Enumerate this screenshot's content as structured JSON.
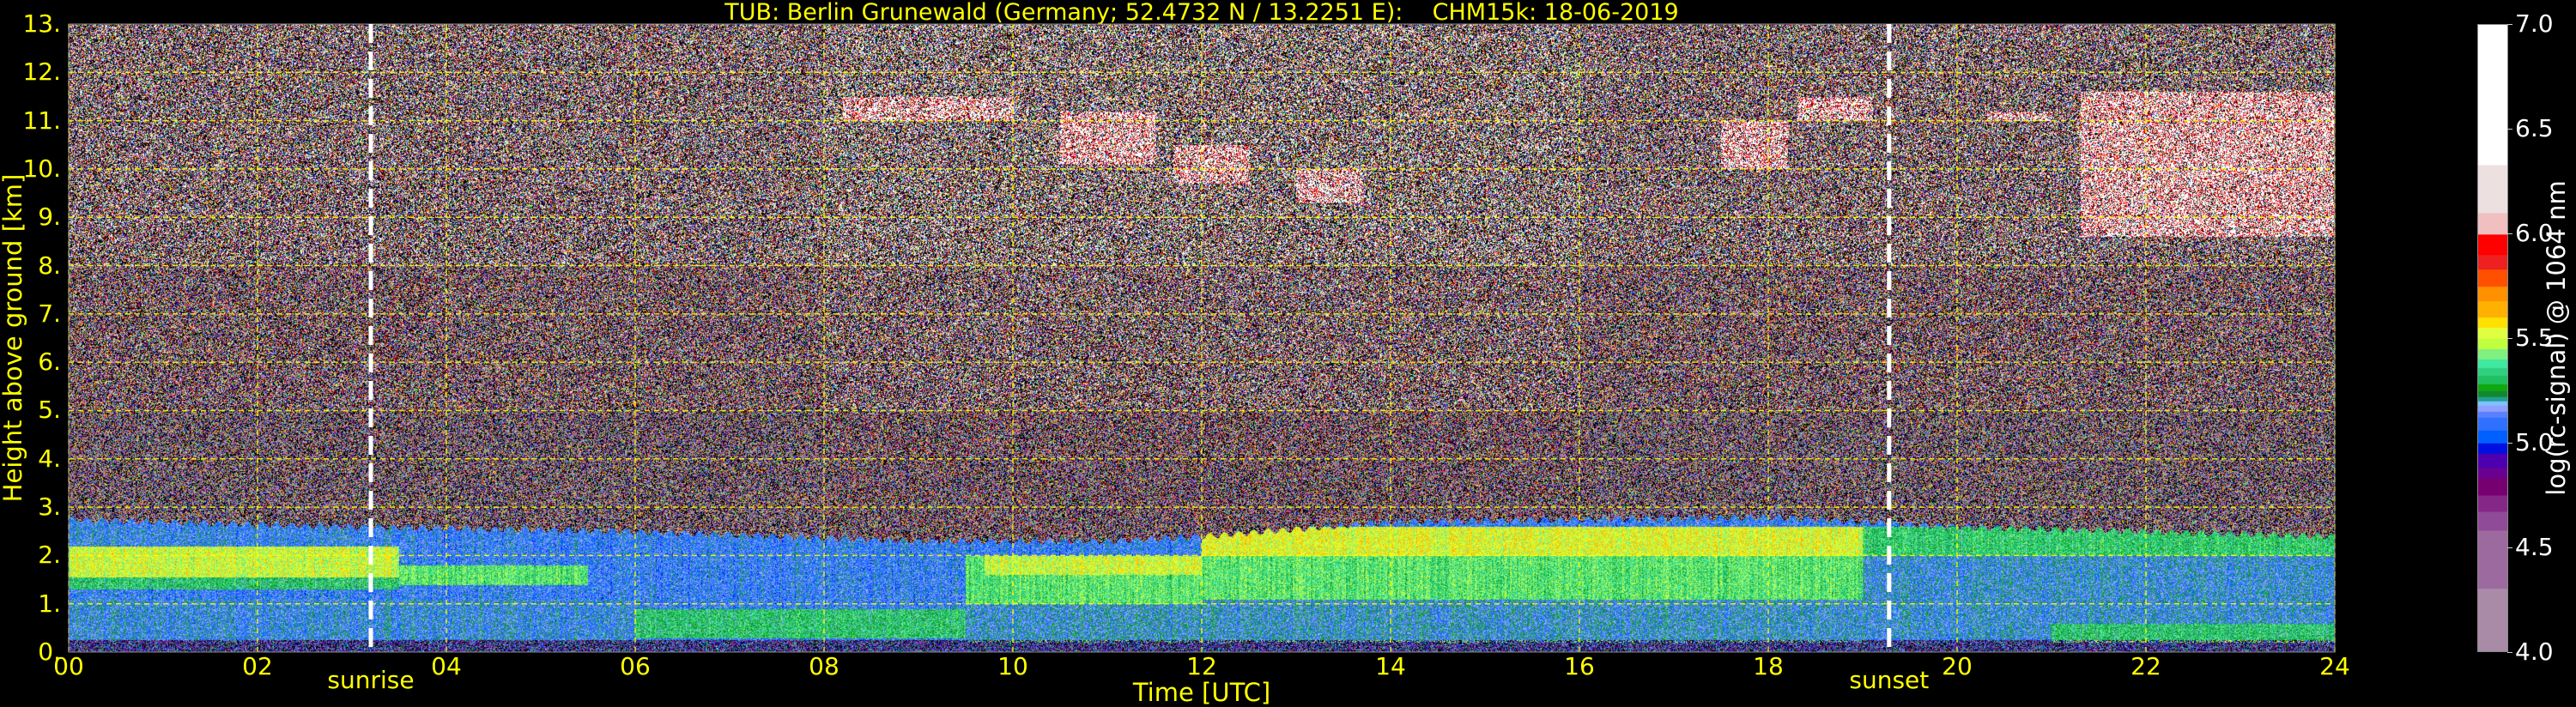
{
  "chart_data": {
    "type": "heatmap",
    "title": "TUB: Berlin Grunewald (Germany; 52.4732 N / 13.2251 E):    CHM15k: 18-06-2019",
    "xlabel": "Time [UTC]",
    "ylabel": "Height above ground [km]",
    "xlim": [
      0,
      24
    ],
    "ylim": [
      0,
      13
    ],
    "grid": true,
    "x_ticks": [
      0,
      2,
      4,
      6,
      8,
      10,
      12,
      14,
      16,
      18,
      20,
      22,
      24
    ],
    "x_tick_labels": [
      "00",
      "02",
      "04",
      "06",
      "08",
      "10",
      "12",
      "14",
      "16",
      "18",
      "20",
      "22",
      "24"
    ],
    "y_ticks": [
      0,
      1,
      2,
      3,
      4,
      5,
      6,
      7,
      8,
      9,
      10,
      11,
      12,
      13
    ],
    "y_tick_labels": [
      "0.",
      "1.",
      "2.",
      "3.",
      "4.",
      "5.",
      "6.",
      "7.",
      "8.",
      "9.",
      "10.",
      "11.",
      "12.",
      "13."
    ],
    "markers": [
      {
        "label": "sunrise",
        "hour": 3.2
      },
      {
        "label": "sunset",
        "hour": 19.28
      }
    ],
    "colorbar": {
      "label": "log(rc-signal) @ 1064 nm",
      "range": [
        4.0,
        7.0
      ],
      "ticks": [
        4.0,
        4.5,
        5.0,
        5.5,
        6.0,
        6.5,
        7.0
      ],
      "tick_labels": [
        "4.0",
        "4.5",
        "5.0",
        "5.5",
        "6.0",
        "6.5",
        "7.0"
      ],
      "levels": [
        [
          4.0,
          "#a98ba8"
        ],
        [
          4.3,
          "#9d6aa0"
        ],
        [
          4.58,
          "#8f4a98"
        ],
        [
          4.67,
          "#852787"
        ],
        [
          4.75,
          "#770070"
        ],
        [
          4.83,
          "#6a0090"
        ],
        [
          4.88,
          "#4d00b0"
        ],
        [
          4.95,
          "#0010e0"
        ],
        [
          5.0,
          "#0060ff"
        ],
        [
          5.06,
          "#3070ff"
        ],
        [
          5.12,
          "#5a80ff"
        ],
        [
          5.15,
          "#90a0ff"
        ],
        [
          5.18,
          "#80c0ff"
        ],
        [
          5.2,
          "#20a090"
        ],
        [
          5.22,
          "#108830"
        ],
        [
          5.25,
          "#10a810"
        ],
        [
          5.28,
          "#20c060"
        ],
        [
          5.32,
          "#30d080"
        ],
        [
          5.36,
          "#40e8a0"
        ],
        [
          5.4,
          "#80f080"
        ],
        [
          5.45,
          "#c0ff40"
        ],
        [
          5.5,
          "#e0ff40"
        ],
        [
          5.55,
          "#ffe000"
        ],
        [
          5.6,
          "#ffb000"
        ],
        [
          5.68,
          "#ff9000"
        ],
        [
          5.75,
          "#ff5000"
        ],
        [
          5.83,
          "#ee2020"
        ],
        [
          5.9,
          "#ff0000"
        ],
        [
          6.0,
          "#f0c0c0"
        ],
        [
          6.1,
          "#ece0e0"
        ],
        [
          6.33,
          "#ffffff"
        ]
      ]
    },
    "boundary_layer_top_km": [
      [
        0,
        2.75
      ],
      [
        3,
        2.6
      ],
      [
        6,
        2.5
      ],
      [
        9,
        2.3
      ],
      [
        11,
        2.3
      ],
      [
        12,
        2.4
      ],
      [
        14,
        2.7
      ],
      [
        18,
        2.8
      ],
      [
        20,
        2.6
      ],
      [
        22,
        2.5
      ],
      [
        24,
        2.4
      ]
    ],
    "aerosol_layers": [
      {
        "t": [
          0,
          24
        ],
        "h": [
          0,
          0.25
        ],
        "value": 4.95
      },
      {
        "t": [
          0,
          6
        ],
        "h": [
          0.25,
          1.1
        ],
        "value": 5.15
      },
      {
        "t": [
          0,
          3.5
        ],
        "h": [
          2.2,
          2.6
        ],
        "value": 5.14
      },
      {
        "t": [
          0,
          3.5
        ],
        "h": [
          1.3,
          1.55
        ],
        "value": 5.3
      },
      {
        "t": [
          0,
          3.5
        ],
        "h": [
          1.55,
          2.2
        ],
        "value": 5.5
      },
      {
        "t": [
          3.5,
          5.5
        ],
        "h": [
          1.4,
          1.8
        ],
        "value": 5.38
      },
      {
        "t": [
          6,
          9.5
        ],
        "h": [
          0.3,
          0.9
        ],
        "value": 5.3
      },
      {
        "t": [
          9.5,
          19
        ],
        "h": [
          0.2,
          1.1
        ],
        "value": 5.17
      },
      {
        "t": [
          9.5,
          12
        ],
        "h": [
          1.0,
          2.0
        ],
        "value": 5.38
      },
      {
        "t": [
          9.7,
          12
        ],
        "h": [
          1.6,
          2.0
        ],
        "value": 5.5
      },
      {
        "t": [
          12,
          19
        ],
        "h": [
          1.1,
          2.4
        ],
        "value": 5.38
      },
      {
        "t": [
          12,
          19
        ],
        "h": [
          2.0,
          2.6
        ],
        "value": 5.52
      },
      {
        "t": [
          19,
          24
        ],
        "h": [
          0.3,
          2.0
        ],
        "value": 5.16
      },
      {
        "t": [
          19,
          24
        ],
        "h": [
          2.0,
          2.6
        ],
        "value": 5.32
      },
      {
        "t": [
          21,
          24
        ],
        "h": [
          0.2,
          0.6
        ],
        "value": 5.3
      }
    ],
    "clouds": [
      {
        "t": [
          8.2,
          10.0
        ],
        "h": [
          11.0,
          11.5
        ]
      },
      {
        "t": [
          10.5,
          11.5
        ],
        "h": [
          10.1,
          11.2
        ]
      },
      {
        "t": [
          11.7,
          12.5
        ],
        "h": [
          9.7,
          10.5
        ]
      },
      {
        "t": [
          13.0,
          13.7
        ],
        "h": [
          9.3,
          10.0
        ]
      },
      {
        "t": [
          17.5,
          18.2
        ],
        "h": [
          10.0,
          11.0
        ]
      },
      {
        "t": [
          18.3,
          19.1
        ],
        "h": [
          11.0,
          11.5
        ]
      },
      {
        "t": [
          20.3,
          21.0
        ],
        "h": [
          11.0,
          11.2
        ]
      },
      {
        "t": [
          21.3,
          24.0
        ],
        "h": [
          8.6,
          11.6
        ]
      }
    ]
  }
}
